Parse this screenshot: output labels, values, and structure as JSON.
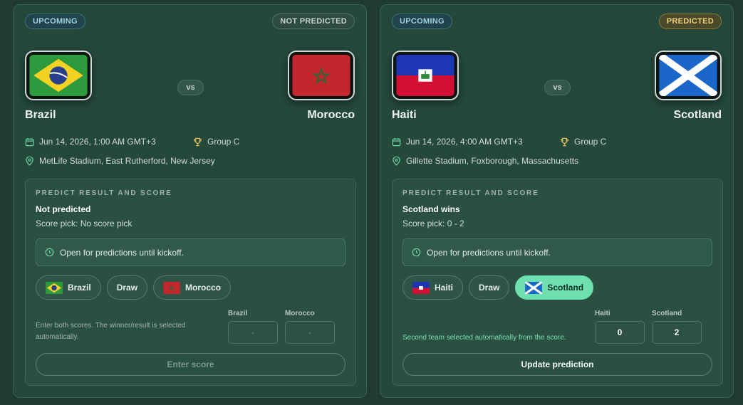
{
  "matches": [
    {
      "status_label": "UPCOMING",
      "prediction_status": "NOT PREDICTED",
      "home": {
        "name": "Brazil",
        "flag": "brazil-flag"
      },
      "away": {
        "name": "Morocco",
        "flag": "morocco-flag"
      },
      "vs_label": "vs",
      "date": "Jun 14, 2026, 1:00 AM GMT+3",
      "group": "Group C",
      "venue": "MetLife Stadium, East Rutherford, New Jersey",
      "predict": {
        "heading": "PREDICT RESULT AND SCORE",
        "result": "Not predicted",
        "score_pick": "Score pick: No score pick",
        "notice": "Open for predictions until kickoff.",
        "choices": {
          "home": "Brazil",
          "draw": "Draw",
          "away": "Morocco",
          "selected": "none"
        },
        "helper": "Enter both scores. The winner/result is selected automatically.",
        "score_labels": {
          "home": "Brazil",
          "away": "Morocco"
        },
        "score_values": {
          "home": "",
          "away": ""
        },
        "score_placeholder": "-",
        "submit_label": "Enter score"
      }
    },
    {
      "status_label": "UPCOMING",
      "prediction_status": "PREDICTED",
      "home": {
        "name": "Haiti",
        "flag": "haiti-flag"
      },
      "away": {
        "name": "Scotland",
        "flag": "scotland-flag"
      },
      "vs_label": "vs",
      "date": "Jun 14, 2026, 4:00 AM GMT+3",
      "group": "Group C",
      "venue": "Gillette Stadium, Foxborough, Massachusetts",
      "predict": {
        "heading": "PREDICT RESULT AND SCORE",
        "result": "Scotland wins",
        "score_pick": "Score pick: 0 - 2",
        "notice": "Open for predictions until kickoff.",
        "choices": {
          "home": "Haiti",
          "draw": "Draw",
          "away": "Scotland",
          "selected": "away"
        },
        "helper": "Second team selected automatically from the score.",
        "score_labels": {
          "home": "Haiti",
          "away": "Scotland"
        },
        "score_values": {
          "home": "0",
          "away": "2"
        },
        "score_placeholder": "",
        "submit_label": "Update prediction"
      }
    }
  ],
  "colors": {
    "background": "#1e3a2f",
    "card": "#24483a",
    "accent_selected": "#6ee0b0",
    "predicted_badge": "#f0d27a",
    "upcoming_badge": "#9fd2e3"
  }
}
